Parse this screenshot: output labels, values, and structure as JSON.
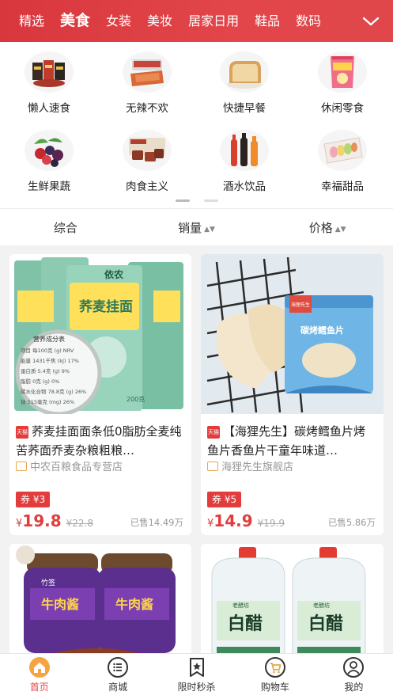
{
  "top_tabs": [
    "精选",
    "美食",
    "女装",
    "美妆",
    "居家日用",
    "鞋品",
    "数码"
  ],
  "active_tab": "美食",
  "categories": [
    {
      "label": "懒人速食",
      "icon": "instant-food-icon"
    },
    {
      "label": "无辣不欢",
      "icon": "spicy-meat-icon"
    },
    {
      "label": "快捷早餐",
      "icon": "bread-icon"
    },
    {
      "label": "休闲零食",
      "icon": "snack-bag-icon"
    },
    {
      "label": "生鲜果蔬",
      "icon": "berries-icon"
    },
    {
      "label": "肉食主义",
      "icon": "meat-icon"
    },
    {
      "label": "酒水饮品",
      "icon": "bottles-icon"
    },
    {
      "label": "幸福甜品",
      "icon": "macaron-icon"
    }
  ],
  "sort_bar": {
    "comprehensive": "综合",
    "sales": "销量",
    "price": "价格",
    "arrows": "▲▼"
  },
  "products": [
    {
      "title": "荞麦挂面面条低0脂肪全麦纯苦荞面乔麦杂粮粗粮…",
      "badge": "天猫",
      "shop": "中农百粮食品专营店",
      "coupon": "券 ¥3",
      "yen": "¥",
      "price": "19.8",
      "old_price": "¥22.8",
      "sold": "已售14.49万",
      "pack_label": "荞麦挂面",
      "pack_brand": "依农",
      "nutrition_header": "营养成分表",
      "nutrition_rows": [
        "项目   每100克 (g)  NRV",
        "能量    1431千焦 (kJ)  17%",
        "蛋白质    5.4克 (g)   9%",
        "脂肪       0克 (g)   0%",
        "碳水化合物 78.8克 (g) 26%",
        "钠      515毫克 (mg) 26%"
      ],
      "pack_weight": "200克"
    },
    {
      "title": "【海狸先生】碳烤鳕鱼片烤鱼片香鱼片干童年味道…",
      "badge": "天猫",
      "shop": "海狸先生旗舰店",
      "coupon": "券 ¥5",
      "yen": "¥",
      "price": "14.9",
      "old_price": "¥19.9",
      "sold": "已售5.86万",
      "pack_label": "碳烤鳕鱼片",
      "pack_brand": "海狸先生"
    },
    {
      "title": "",
      "pack_label": "牛肉酱",
      "pack_brand": "竹签"
    },
    {
      "title": "",
      "pack_label": "白醋",
      "pack_brand": "老醋坊"
    }
  ],
  "bottom_nav": [
    {
      "label": "首页",
      "icon": "home-icon",
      "active": true
    },
    {
      "label": "商城",
      "icon": "list-icon",
      "active": false
    },
    {
      "label": "限时秒杀",
      "icon": "bookmark-star-icon",
      "active": false
    },
    {
      "label": "购物车",
      "icon": "cart-icon",
      "active": false
    },
    {
      "label": "我的",
      "icon": "user-icon",
      "active": false
    }
  ],
  "colors": {
    "brand": "#e0474b",
    "price": "#e23c3c",
    "coupon": "#e23c3c"
  }
}
